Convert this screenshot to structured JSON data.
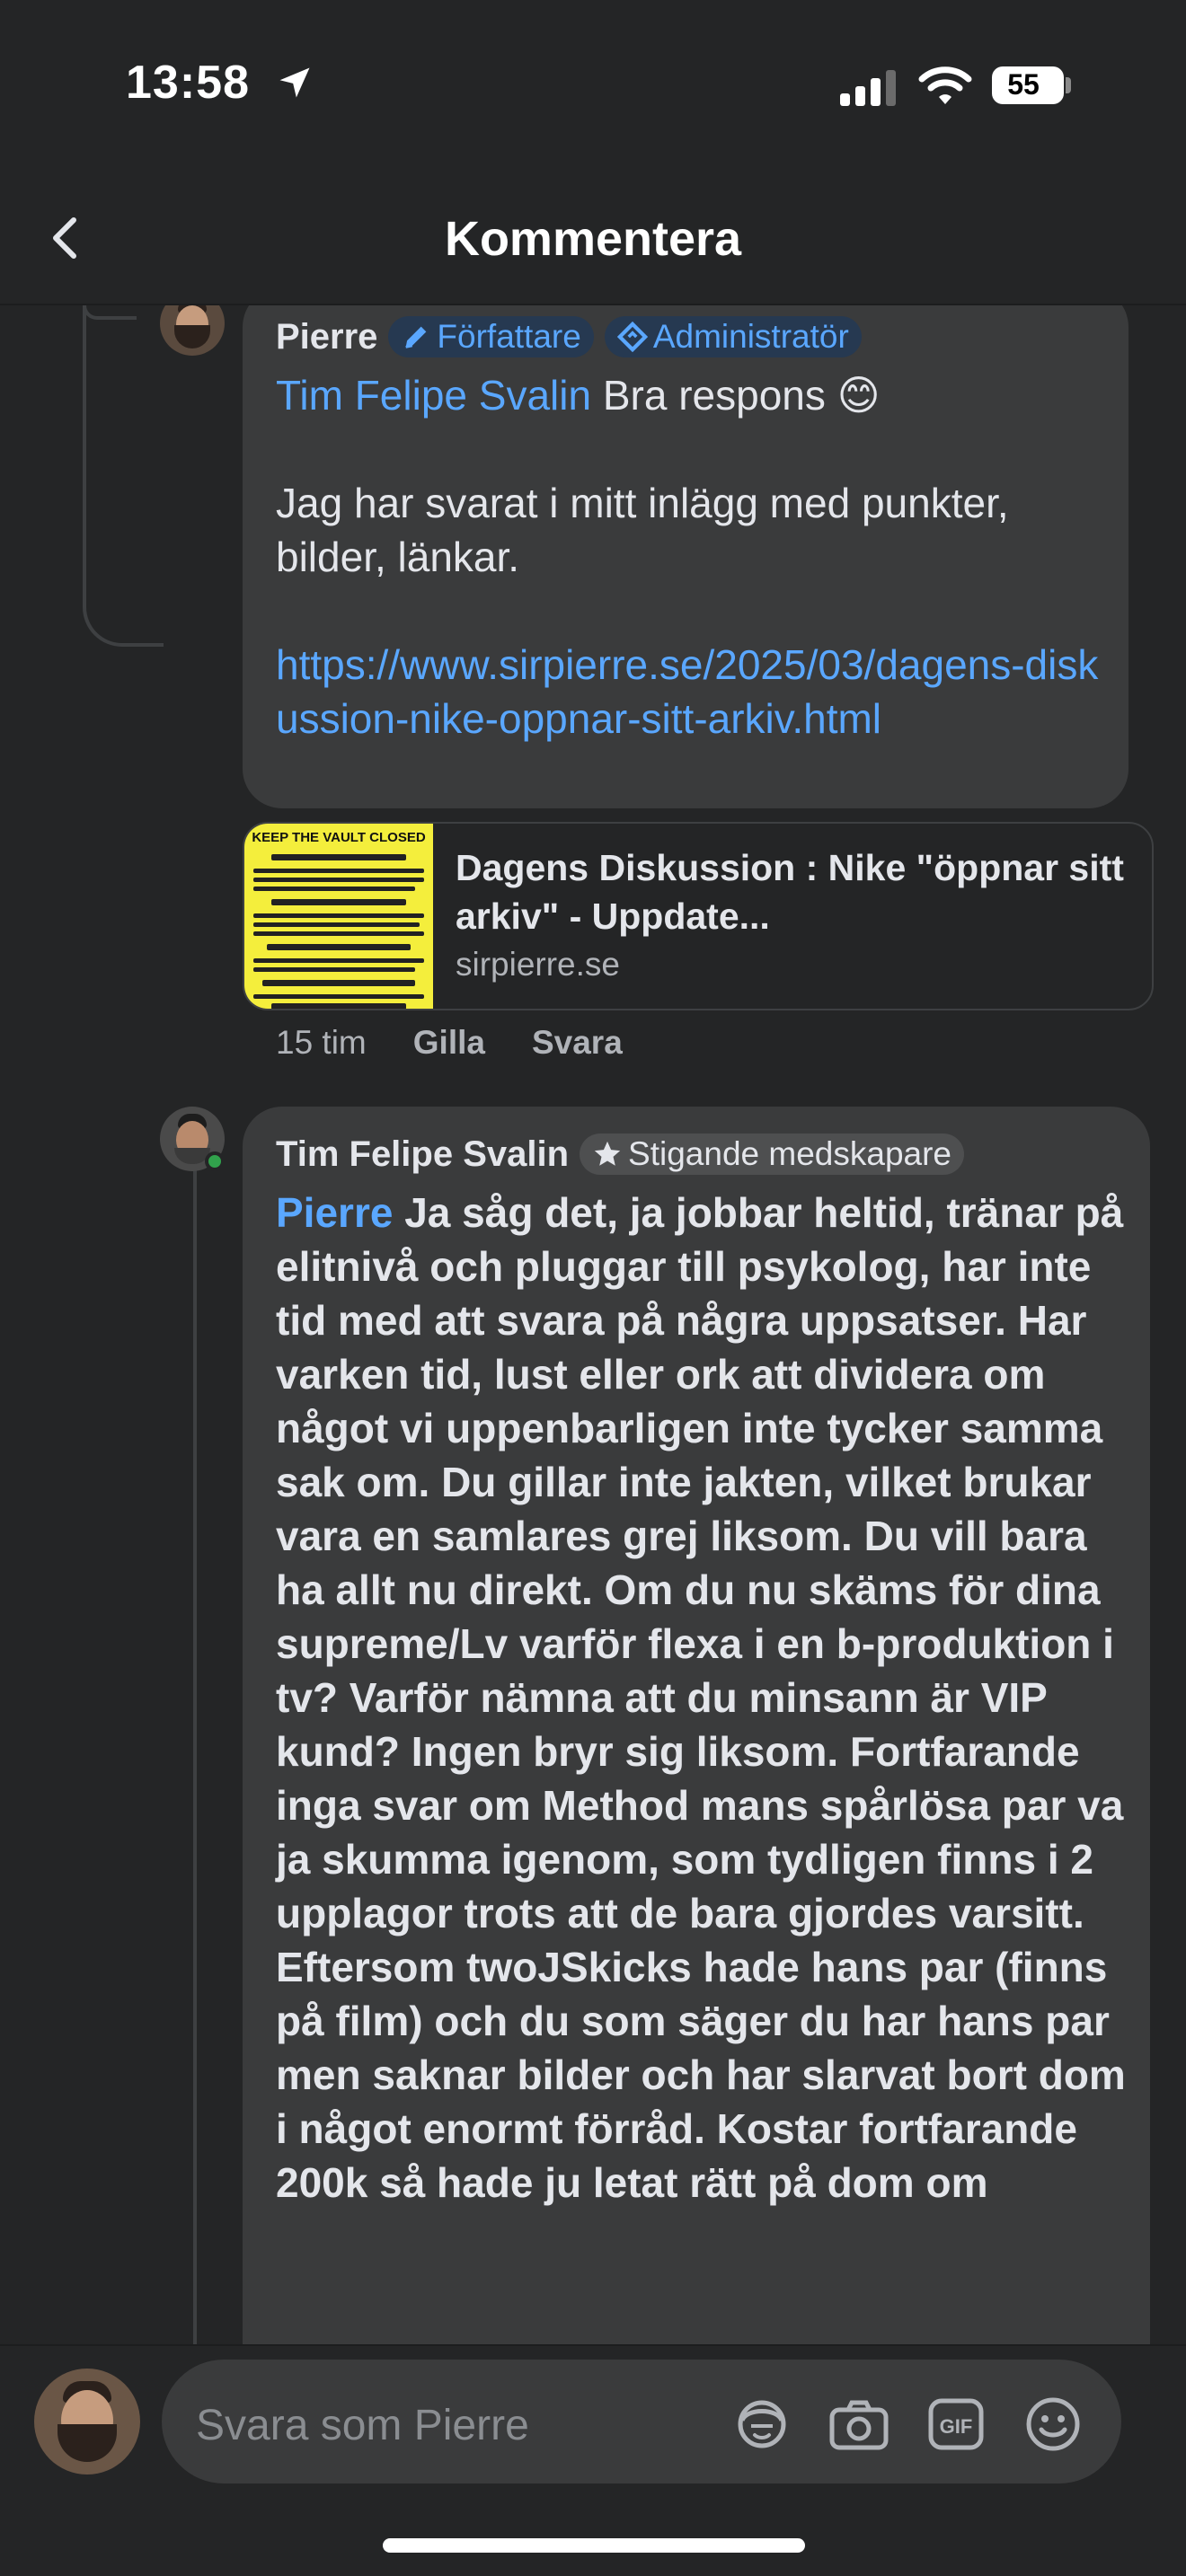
{
  "status_bar": {
    "time": "13:58",
    "battery": "55"
  },
  "header": {
    "title": "Kommentera"
  },
  "comments": [
    {
      "author": "Pierre",
      "badges": [
        "Författare",
        "Administratör"
      ],
      "mention": "Tim Felipe Svalin",
      "text_after_mention": " Bra respons 😊",
      "paragraph": "Jag har svarat i mitt inlägg med punkter, bilder, länkar.",
      "link": "https://www.sirpierre.se/2025/03/dagens-diskussion-nike-oppnar-sitt-arkiv.html",
      "link_preview": {
        "title": "Dagens Diskussion : Nike \"öppnar sitt arkiv\" - Uppdate...",
        "domain": "sirpierre.se",
        "thumb_title": "KEEP THE VAULT CLOSED"
      },
      "time": "15 tim",
      "like_label": "Gilla",
      "reply_label": "Svara"
    },
    {
      "author": "Tim Felipe Svalin",
      "badges": [
        "Stigande medskapare"
      ],
      "mention": "Pierre",
      "text": " Ja såg det, ja jobbar heltid, tränar på elitnivå och pluggar till psykolog, har inte tid med att svara på några uppsatser. Har varken tid, lust eller ork att dividera om något vi uppenbarligen inte tycker samma sak om. Du gillar inte jakten, vilket brukar vara en samlares grej liksom. Du vill bara ha allt nu direkt. Om du nu skäms för dina supreme/Lv varför flexa i en b-produktion i tv? Varför nämna att du minsann är VIP kund? Ingen bryr sig liksom. Fortfarande inga svar om Method mans spårlösa par va ja skumma igenom, som tydligen finns i 2 upplagor trots att de bara gjordes varsitt. Eftersom twoJSkicks hade hans par (finns på film) och du som säger du har hans par men saknar bilder och har slarvat bort dom i något enormt förråd. Kostar fortfarande 200k så hade ju letat rätt på dom om"
    }
  ],
  "composer": {
    "placeholder": "Svara som Pierre"
  }
}
